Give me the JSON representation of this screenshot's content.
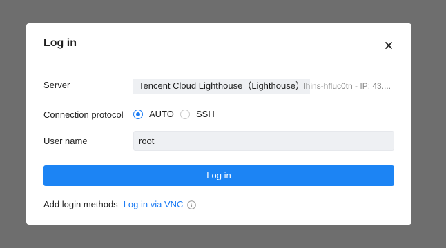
{
  "dialog": {
    "title": "Log in",
    "close_icon": "close-icon"
  },
  "server": {
    "label": "Server",
    "value": "Tencent Cloud Lighthouse（Lighthouse）",
    "meta": "lhins-hfluc0tn - IP: 43...."
  },
  "protocol": {
    "label": "Connection protocol",
    "options": [
      {
        "label": "AUTO",
        "selected": true
      },
      {
        "label": "SSH",
        "selected": false
      }
    ]
  },
  "username": {
    "label": "User name",
    "value": "root"
  },
  "login_button": {
    "label": "Log in"
  },
  "add_methods": {
    "label": "Add login methods",
    "link": "Log in via VNC",
    "info_icon": "info-icon"
  },
  "colors": {
    "accent": "#1c84f4",
    "overlay": "#6e6e6e"
  }
}
